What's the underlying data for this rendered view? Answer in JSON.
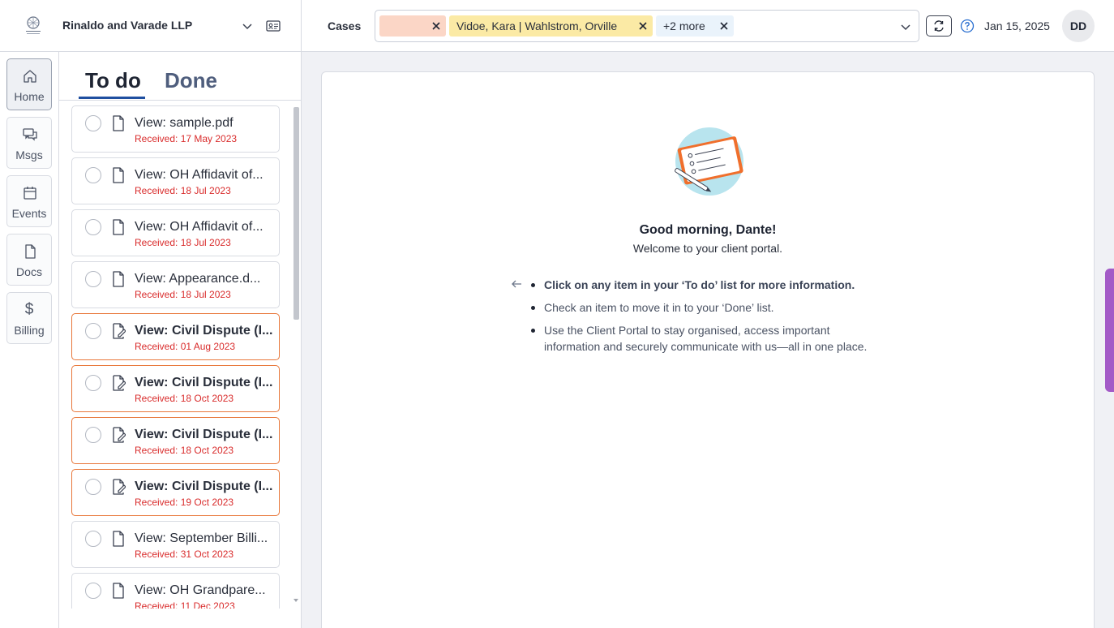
{
  "firm": {
    "name": "Rinaldo and Varade LLP",
    "logo_text": "LAW FIRM"
  },
  "topbar": {
    "cases_label": "Cases",
    "chips": [
      {
        "label": "",
        "color": "#fbd6c6"
      },
      {
        "label": "Vidoe, Kara | Wahlstrom, Orville",
        "color": "#fbeaa5"
      },
      {
        "label": "+2 more",
        "color": "#eaf3fb"
      }
    ],
    "date": "Jan 15, 2025",
    "avatar_initials": "DD"
  },
  "nav": [
    {
      "label": "Home",
      "icon": "home-icon",
      "active": true
    },
    {
      "label": "Msgs",
      "icon": "messages-icon",
      "active": false
    },
    {
      "label": "Events",
      "icon": "calendar-icon",
      "active": false
    },
    {
      "label": "Docs",
      "icon": "document-icon",
      "active": false
    },
    {
      "label": "Billing",
      "icon": "dollar-icon",
      "symbol": "$",
      "active": false
    }
  ],
  "tabs": {
    "todo": "To do",
    "done": "Done"
  },
  "todos": [
    {
      "title": "View: sample.pdf",
      "received": "Received: 17 May 2023",
      "flagged": false
    },
    {
      "title": "View: OH Affidavit of...",
      "received": "Received: 18 Jul 2023",
      "flagged": false
    },
    {
      "title": "View: OH Affidavit of...",
      "received": "Received: 18 Jul 2023",
      "flagged": false
    },
    {
      "title": "View: Appearance.d...",
      "received": "Received: 18 Jul 2023",
      "flagged": false
    },
    {
      "title": "View: Civil Dispute (I...",
      "received": "Received: 01 Aug 2023",
      "flagged": true
    },
    {
      "title": "View: Civil Dispute (I...",
      "received": "Received: 18 Oct 2023",
      "flagged": true
    },
    {
      "title": "View: Civil Dispute (I...",
      "received": "Received: 18 Oct 2023",
      "flagged": true
    },
    {
      "title": "View: Civil Dispute (I...",
      "received": "Received: 19 Oct 2023",
      "flagged": true
    },
    {
      "title": "View: September Billi...",
      "received": "Received: 31 Oct 2023",
      "flagged": false
    },
    {
      "title": "View: OH Grandpare...",
      "received": "Received: 11 Dec 2023",
      "flagged": false
    }
  ],
  "main": {
    "greeting": "Good morning, Dante!",
    "welcome": "Welcome to your client portal.",
    "bullets": [
      "Click on any item in your ‘To do’ list for more information.",
      "Check an item to move it in to your ‘Done’ list.",
      "Use the Client Portal to stay organised, access important information and securely communicate with us—all in one place."
    ]
  },
  "colors": {
    "accent": "#1f4fa0",
    "flag_border": "#e8773a",
    "received_text": "#d92c2c",
    "side_tab": "#a35ac7"
  }
}
